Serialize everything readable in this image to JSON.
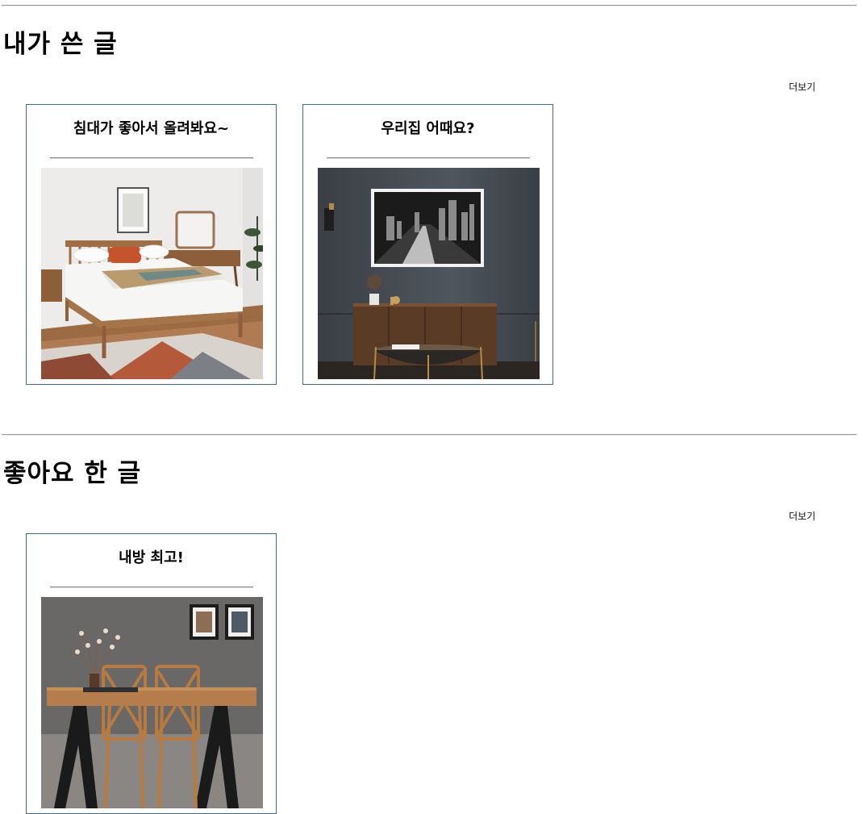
{
  "my_posts": {
    "title": "내가 쓴 글",
    "more_label": "더보기",
    "cards": [
      {
        "title": "침대가 좋아서 올려봐요~",
        "photo": "bedroom-photo"
      },
      {
        "title": "우리집 어때요?",
        "photo": "living-room-photo"
      }
    ]
  },
  "liked_posts": {
    "title": "좋아요 한 글",
    "more_label": "더보기",
    "cards": [
      {
        "title": "내방 최고!",
        "photo": "dining-room-photo"
      }
    ]
  },
  "colors": {
    "card_border": "#3d6a8f",
    "rule": "#9a9a9a"
  }
}
